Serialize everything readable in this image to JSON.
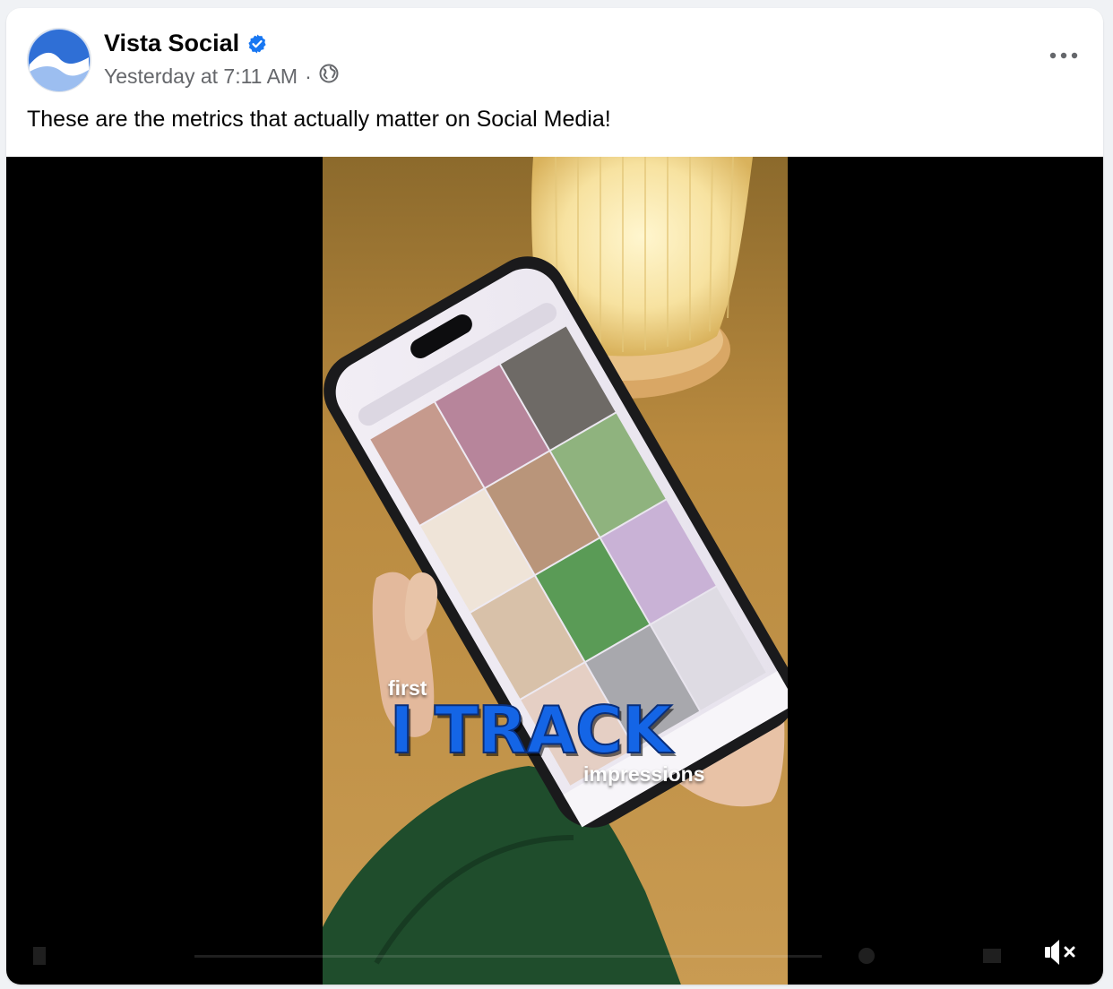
{
  "post": {
    "author": "Vista Social",
    "timestamp": "Yesterday at 7:11 AM",
    "separator": "·",
    "text": "These are the metrics that actually matter on Social Media!"
  },
  "video": {
    "caption_small_top": "first",
    "caption_main": "I TRACK",
    "caption_small_bottom": "impressions",
    "muted": true
  },
  "icons": {
    "verified": "verified-badge-icon",
    "audience": "globe-icon",
    "more": "more-options-icon",
    "mute": "speaker-muted-icon"
  },
  "colors": {
    "verified_blue": "#1877f2",
    "caption_blue": "#1465e6",
    "avatar_blue": "#2f6fd6"
  }
}
